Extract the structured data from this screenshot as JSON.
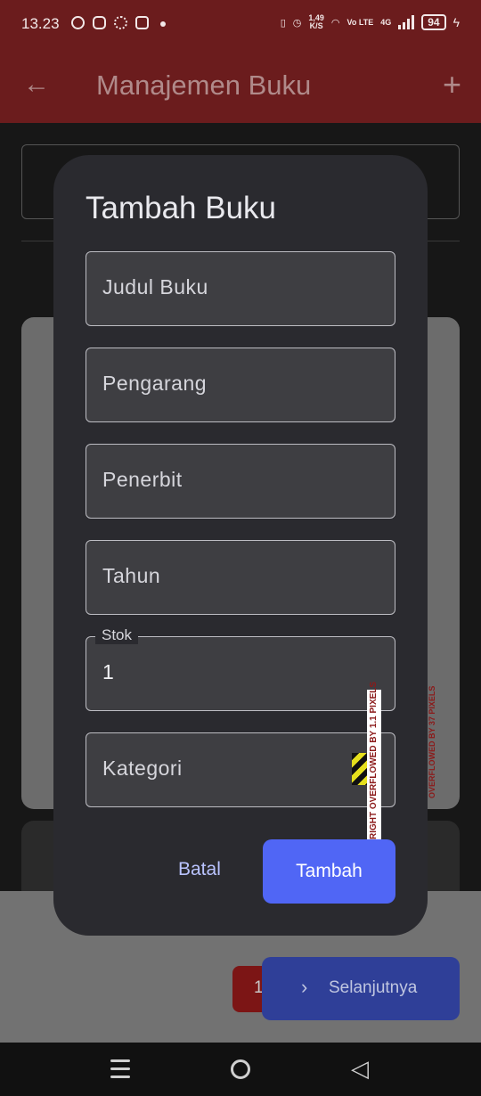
{
  "status_bar": {
    "time": "13.23",
    "net_speed_value": "1,49",
    "net_speed_unit": "K/S",
    "volte": "Vo LTE",
    "network": "4G",
    "battery": "94",
    "icons": [
      "whatsapp-icon",
      "messenger-icon",
      "settings-icon",
      "instagram-icon",
      "dot-icon",
      "vibrate-icon",
      "alarm-icon",
      "wifi-icon",
      "signal-icon",
      "charging-icon"
    ]
  },
  "appbar": {
    "title": "Manajemen Buku",
    "back_icon": "arrow-left-icon",
    "add_icon": "plus-icon"
  },
  "dialog": {
    "title": "Tambah Buku",
    "fields": {
      "judul": {
        "placeholder": "Judul Buku"
      },
      "pengarang": {
        "placeholder": "Pengarang"
      },
      "penerbit": {
        "placeholder": "Penerbit"
      },
      "tahun": {
        "placeholder": "Tahun"
      },
      "stok": {
        "label": "Stok",
        "value": "1"
      },
      "kategori": {
        "placeholder": "Kategori"
      }
    },
    "overflow_warning": "RIGHT OVERFLOWED BY 1.1 PIXELS",
    "cancel_label": "Batal",
    "submit_label": "Tambah"
  },
  "background": {
    "overflow_warning": "OVERFLOWED BY 37 PIXELS",
    "page_number": "1",
    "next_label": "Selanjutnya"
  },
  "colors": {
    "appbar": "#6b1c1d",
    "dialog": "#2a2a2f",
    "primary_button": "#5066f5",
    "cancel_text": "#b9c3ff"
  }
}
